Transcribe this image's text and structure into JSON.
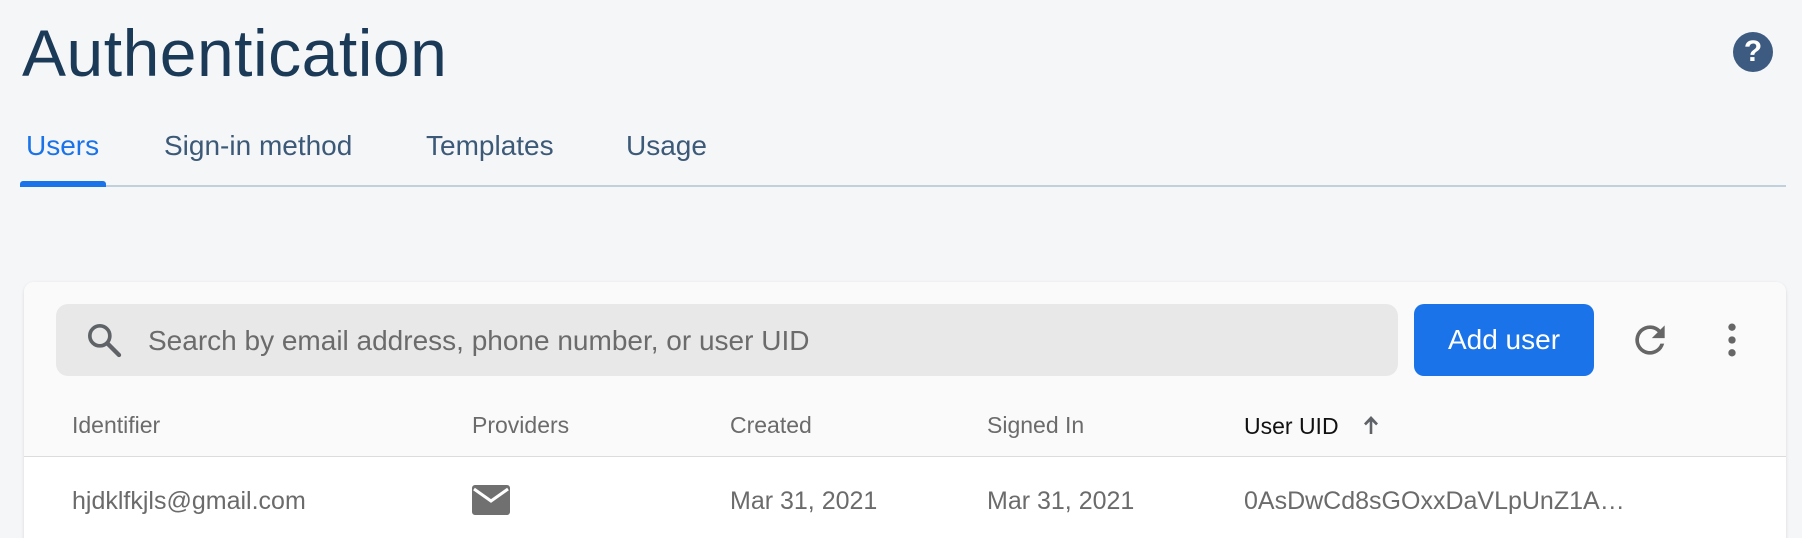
{
  "header": {
    "title": "Authentication",
    "help_icon": "help-circle-icon",
    "help_glyph": "?"
  },
  "tabs": [
    {
      "label": "Users",
      "active": true
    },
    {
      "label": "Sign-in method",
      "active": false
    },
    {
      "label": "Templates",
      "active": false
    },
    {
      "label": "Usage",
      "active": false
    }
  ],
  "toolbar": {
    "search_placeholder": "Search by email address, phone number, or user UID",
    "search_value": "",
    "add_user_label": "Add user",
    "refresh_icon": "refresh-icon",
    "more_icon": "more-vert-icon"
  },
  "table": {
    "columns": [
      "Identifier",
      "Providers",
      "Created",
      "Signed In",
      "User UID"
    ],
    "sorted_column": "User UID",
    "sort_direction": "ascending",
    "rows": [
      {
        "identifier": "hjdklfkjls@gmail.com",
        "provider_icon": "email-icon",
        "created": "Mar 31, 2021",
        "signed_in": "Mar 31, 2021",
        "uid": "0AsDwCd8sGOxxDaVLpUnZ1A…"
      }
    ]
  },
  "colors": {
    "accent": "#1a73e8",
    "title": "#1b3a57",
    "tab_text": "#3c5a78",
    "help_bg": "#3d5a80"
  }
}
